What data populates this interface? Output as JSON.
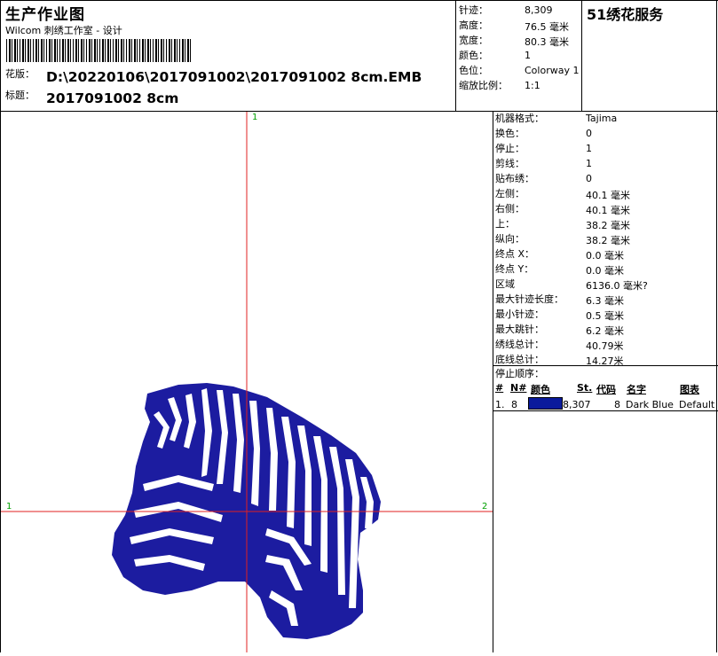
{
  "header": {
    "title": "生产作业图",
    "subtitle": "Wilcom 刺绣工作室 - 设计",
    "design_label": "花版：",
    "design_path": "D:\\20220106\\2017091002\\2017091002 8cm.EMB",
    "title_label": "标题：",
    "title_value": "2017091002 8cm"
  },
  "summary": [
    {
      "label": "针迹：",
      "value": "8,309"
    },
    {
      "label": "高度：",
      "value": "76.5 毫米"
    },
    {
      "label": "宽度：",
      "value": "80.3 毫米"
    },
    {
      "label": "颜色：",
      "value": "1"
    },
    {
      "label": "色位：",
      "value": "Colorway 1"
    },
    {
      "label": "缩放比例：",
      "value": "1:1"
    }
  ],
  "brand": "51绣花服务",
  "details": [
    {
      "label": "机器格式：",
      "value": "Tajima"
    },
    {
      "label": "换色：",
      "value": "0"
    },
    {
      "label": "停止：",
      "value": "1"
    },
    {
      "label": "剪线：",
      "value": "1"
    },
    {
      "label": "贴布绣：",
      "value": "0"
    },
    {
      "label": "左侧：",
      "value": "40.1 毫米"
    },
    {
      "label": "右侧：",
      "value": "40.1 毫米"
    },
    {
      "label": "上：",
      "value": "38.2 毫米"
    },
    {
      "label": "纵向：",
      "value": "38.2 毫米"
    },
    {
      "label": "终点 X：",
      "value": "0.0 毫米"
    },
    {
      "label": "终点 Y：",
      "value": "0.0 毫米"
    },
    {
      "label": "区域",
      "value": "6136.0 毫米?"
    },
    {
      "label": "最大针迹长度：",
      "value": "6.3 毫米"
    },
    {
      "label": "最小针迹：",
      "value": "0.5 毫米"
    },
    {
      "label": "最大跳针：",
      "value": "6.2 毫米"
    },
    {
      "label": "绣线总计：",
      "value": "40.79米"
    },
    {
      "label": "底线总计：",
      "value": "14.27米"
    }
  ],
  "stop_sequence": {
    "title": "停止顺序：",
    "headers": {
      "num": "#",
      "n": "N#",
      "color": "颜色",
      "st": "St.",
      "code": "代码",
      "name": "名字",
      "chart": "图表"
    },
    "rows": [
      {
        "num": "1.",
        "n": "8",
        "swatch": "#0a1a9c",
        "st": "8,307",
        "code": "8",
        "name": "Dark Blue",
        "chart": "Default"
      }
    ]
  },
  "crosshair": {
    "top": "1",
    "left": "1",
    "right": "2"
  },
  "colors": {
    "stitch": "#1c1ca0",
    "crosshair": "#e02020",
    "marker": "#00a000"
  }
}
